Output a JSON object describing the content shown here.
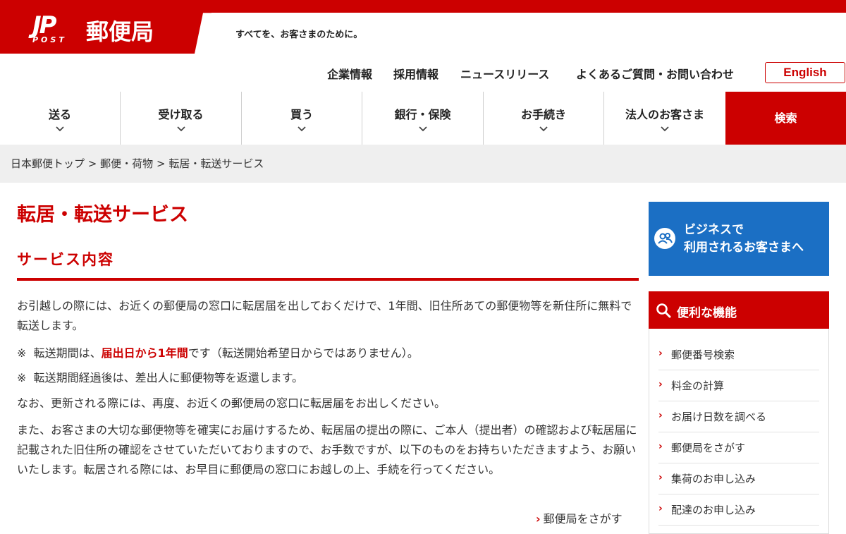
{
  "brand": {
    "logo_mark": "JP",
    "logo_sub": "POST",
    "name": "郵便局",
    "tagline": "すべてを、お客さまのために。"
  },
  "utility": {
    "links": [
      "企業情報",
      "採用情報",
      "ニュースリリース",
      "よくあるご質問・お問い合わせ"
    ],
    "language": "English"
  },
  "nav": {
    "items": [
      "送る",
      "受け取る",
      "買う",
      "銀行・保険",
      "お手続き",
      "法人のお客さま"
    ],
    "search": "検索"
  },
  "breadcrumb": [
    "日本郵便トップ",
    "郵便・荷物",
    "転居・転送サービス"
  ],
  "breadcrumb_separator": ">",
  "main": {
    "title": "転居・転送サービス",
    "section_title": "サービス内容",
    "intro": "お引越しの際には、お近くの郵便局の窓口に転居届を出しておくだけで、1年間、旧住所あての郵便物等を新住所に無料で転送します。",
    "note1": {
      "mark": "※",
      "before": "転送期間は、",
      "emphasis": "届出日から1年間",
      "after": "です（転送開始希望日からではありません）。"
    },
    "note2": {
      "mark": "※",
      "text": "転送期間経過後は、差出人に郵便物等を返還します。"
    },
    "renewal": "なお、更新される際には、再度、お近くの郵便局の窓口に転居届をお出しください。",
    "verification": "また、お客さまの大切な郵便物等を確実にお届けするため、転居届の提出の際に、ご本人（提出者）の確認および転居届に記載された旧住所の確認をさせていただいておりますので、お手数ですが、以下のものをお持ちいただきますよう、お願いいたします。転居される際には、お早目に郵便局の窓口にお越しの上、手続を行ってください。",
    "find_office_link": "郵便局をさがす"
  },
  "sidebar": {
    "business_banner": [
      "ビジネスで",
      "利用されるお客さまへ"
    ],
    "functions_title": "便利な機能",
    "functions": [
      "郵便番号検索",
      "料金の計算",
      "お届け日数を調べる",
      "郵便局をさがす",
      "集荷のお申し込み",
      "配達のお申し込み"
    ]
  },
  "colors": {
    "brand_red": "#cc0000",
    "business_blue": "#1b6fc4",
    "breadcrumb_bg": "#efefef"
  }
}
